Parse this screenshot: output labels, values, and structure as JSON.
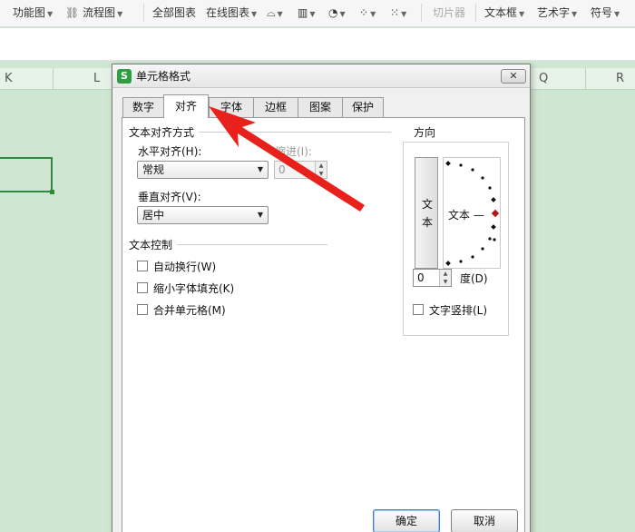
{
  "ribbon": {
    "items": [
      "功能图",
      "流程图",
      "全部图表",
      "在线图表",
      "切片器",
      "文本框",
      "艺术字",
      "符号"
    ]
  },
  "columns": [
    "K",
    "L",
    "Q",
    "R"
  ],
  "dialog": {
    "title": "单元格格式",
    "app_icon": "S",
    "close_label": "✕",
    "tabs": [
      "数字",
      "对齐",
      "字体",
      "边框",
      "图案",
      "保护"
    ],
    "alignment": {
      "group_title": "文本对齐方式",
      "horizontal_label": "水平对齐(H):",
      "horizontal_value": "常规",
      "indent_label": "缩进(I):",
      "indent_value": "0",
      "vertical_label": "垂直对齐(V):",
      "vertical_value": "居中"
    },
    "control": {
      "group_title": "文本控制",
      "options": [
        "自动换行(W)",
        "缩小字体填充(K)",
        "合并单元格(M)"
      ]
    },
    "orientation": {
      "group_title": "方向",
      "vertical_text": [
        "文",
        "本"
      ],
      "dial_text": "文本 —",
      "degree_value": "0",
      "degree_label": "度(D)",
      "vertical_text_checkbox": "文字竖排(L)"
    },
    "buttons": {
      "ok": "确定",
      "cancel": "取消"
    }
  },
  "colors": {
    "sheet_background": "#cfe6d2",
    "selection_border": "#2c8a3a",
    "annotation_arrow": "#e8211c",
    "app_icon": "#2f9e3f"
  }
}
